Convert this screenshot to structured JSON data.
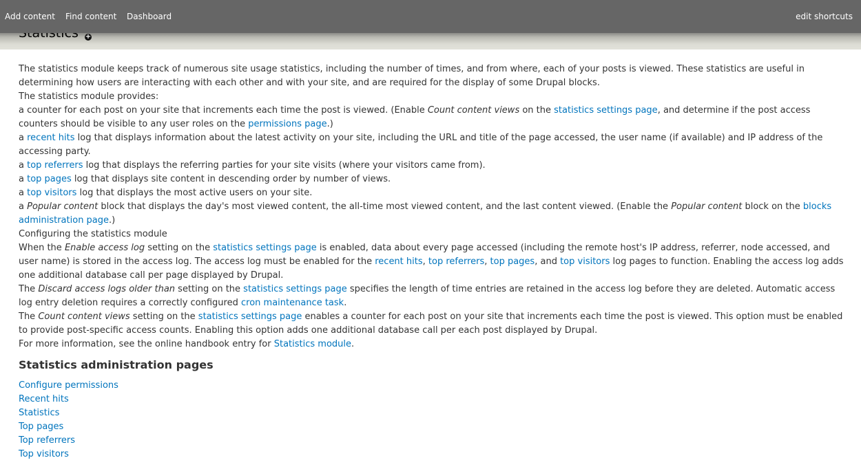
{
  "toolbar": {
    "shortcuts": [
      "Add content",
      "Find content",
      "Dashboard"
    ],
    "edit_shortcuts": "edit shortcuts"
  },
  "page": {
    "title": "Statistics",
    "add_shortcut_icon": "plus-circle-icon"
  },
  "colors": {
    "link": "#0074bd",
    "toolbar": "#666666"
  },
  "help": [
    [
      {
        "t": "The statistics module keeps track of numerous site usage statistics, including the number of times, and from where, each of your posts is viewed. These statistics are useful in determining how users are interacting with each other and with your site, and are required for the display of some Drupal blocks."
      }
    ],
    [
      {
        "t": "The statistics module provides:"
      }
    ],
    [
      {
        "t": "a counter for each post on your site that increments each time the post is viewed. (Enable "
      },
      {
        "t": "Count content views",
        "em": true
      },
      {
        "t": " on the "
      },
      {
        "t": "statistics settings page",
        "link": true
      },
      {
        "t": ", and determine if the post access counters should be visible to any user roles on the "
      },
      {
        "t": "permissions page",
        "link": true
      },
      {
        "t": ".)"
      }
    ],
    [
      {
        "t": "a "
      },
      {
        "t": "recent hits",
        "link": true
      },
      {
        "t": " log that displays information about the latest activity on your site, including the URL and title of the page accessed, the user name (if available) and IP address of the accessing party."
      }
    ],
    [
      {
        "t": "a "
      },
      {
        "t": "top referrers",
        "link": true
      },
      {
        "t": " log that displays the referring parties for your site visits (where your visitors came from)."
      }
    ],
    [
      {
        "t": "a "
      },
      {
        "t": "top pages",
        "link": true
      },
      {
        "t": " log that displays site content in descending order by number of views."
      }
    ],
    [
      {
        "t": "a "
      },
      {
        "t": "top visitors",
        "link": true
      },
      {
        "t": " log that displays the most active users on your site."
      }
    ],
    [
      {
        "t": "a "
      },
      {
        "t": "Popular content",
        "em": true
      },
      {
        "t": " block that displays the day's most viewed content, the all-time most viewed content, and the last content viewed. (Enable the "
      },
      {
        "t": "Popular content",
        "em": true
      },
      {
        "t": " block on the "
      },
      {
        "t": "blocks administration page",
        "link": true
      },
      {
        "t": ".)"
      }
    ],
    [
      {
        "t": "Configuring the statistics module"
      }
    ],
    [
      {
        "t": "When the "
      },
      {
        "t": "Enable access log",
        "em": true
      },
      {
        "t": " setting on the "
      },
      {
        "t": "statistics settings page",
        "link": true
      },
      {
        "t": " is enabled, data about every page accessed (including the remote host's IP address, referrer, node accessed, and user name) is stored in the access log. The access log must be enabled for the "
      },
      {
        "t": "recent hits",
        "link": true
      },
      {
        "t": ", "
      },
      {
        "t": "top referrers",
        "link": true
      },
      {
        "t": ", "
      },
      {
        "t": "top pages",
        "link": true
      },
      {
        "t": ", and "
      },
      {
        "t": "top visitors",
        "link": true
      },
      {
        "t": " log pages to function. Enabling the access log adds one additional database call per page displayed by Drupal."
      }
    ],
    [
      {
        "t": "The "
      },
      {
        "t": "Discard access logs older than",
        "em": true
      },
      {
        "t": " setting on the "
      },
      {
        "t": "statistics settings page",
        "link": true
      },
      {
        "t": " specifies the length of time entries are retained in the access log before they are deleted. Automatic access log entry deletion requires a correctly configured "
      },
      {
        "t": "cron maintenance task",
        "link": true
      },
      {
        "t": "."
      }
    ],
    [
      {
        "t": "The "
      },
      {
        "t": "Count content views",
        "em": true
      },
      {
        "t": " setting on the "
      },
      {
        "t": "statistics settings page",
        "link": true
      },
      {
        "t": " enables a counter for each post on your site that increments each time the post is viewed. This option must be enabled to provide post-specific access counts. Enabling this option adds one additional database call per each post displayed by Drupal."
      }
    ],
    [
      {
        "t": "For more information, see the online handbook entry for "
      },
      {
        "t": "Statistics module",
        "link": true
      },
      {
        "t": "."
      }
    ]
  ],
  "admin": {
    "heading": "Statistics administration pages",
    "links": [
      "Configure permissions",
      "Recent hits",
      "Statistics",
      "Top pages",
      "Top referrers",
      "Top visitors"
    ]
  }
}
